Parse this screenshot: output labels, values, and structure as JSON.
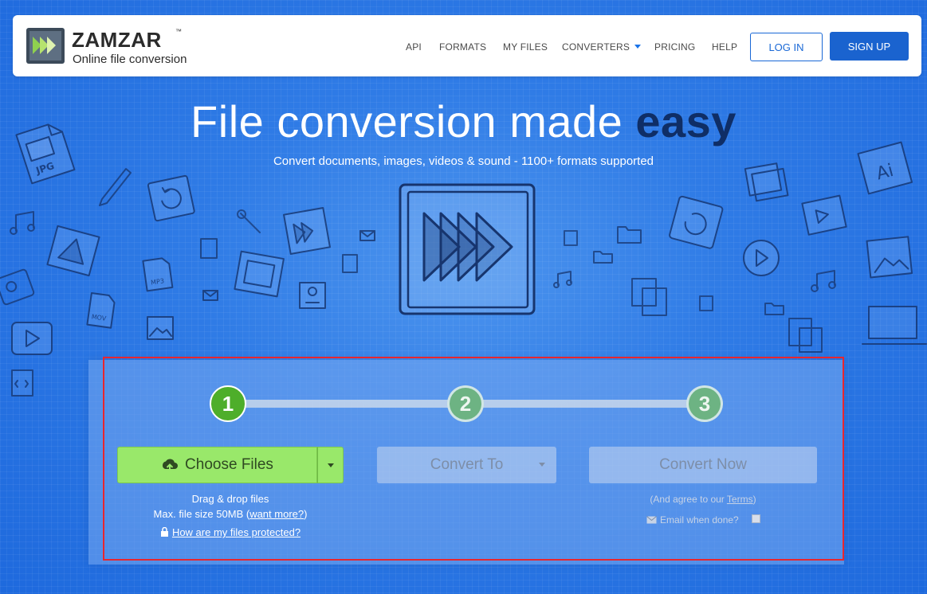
{
  "header": {
    "logo_word": "ZAMZAR",
    "logo_tm": "™",
    "logo_tagline": "Online file conversion",
    "nav": {
      "api": "API",
      "formats": "FORMATS",
      "my_files": "MY FILES",
      "converters": "CONVERTERS",
      "pricing": "PRICING",
      "help": "HELP"
    },
    "login_label": "LOG IN",
    "signup_label": "SIGN UP"
  },
  "hero": {
    "title_main": "File conversion made ",
    "title_emphasis": "easy",
    "subtitle": "Convert documents, images, videos & sound - 1100+ formats supported"
  },
  "doodle_labels": {
    "jpg": "JPG",
    "mp3": "MP3",
    "mov": "MOV",
    "ai": "Ai"
  },
  "converter": {
    "steps": [
      "1",
      "2",
      "3"
    ],
    "active_step": "1",
    "choose_files_label": "Choose Files",
    "drag_drop_text": "Drag & drop files",
    "max_size_text": "Max. file size 50MB",
    "want_more_text": "want more?",
    "protected_link": "How are my files protected?",
    "convert_to_label": "Convert To",
    "convert_now_label": "Convert Now",
    "agree_prefix": "(And agree to our ",
    "terms_link": "Terms",
    "agree_suffix": ")",
    "email_label": "Email when done?",
    "email_checked": false
  },
  "colors": {
    "background": "#2f7be6",
    "accent_blue": "#1a63cf",
    "choose_green": "#99e86a",
    "step_active": "#4eae2a",
    "highlight_red": "#e8262f",
    "title_emphasis": "#0f2e66"
  },
  "icons": {
    "logo": "zamzar-logo-icon",
    "upload": "cloud-upload-icon",
    "lock": "lock-icon",
    "email": "envelope-icon",
    "hero": "fast-forward-icon"
  }
}
